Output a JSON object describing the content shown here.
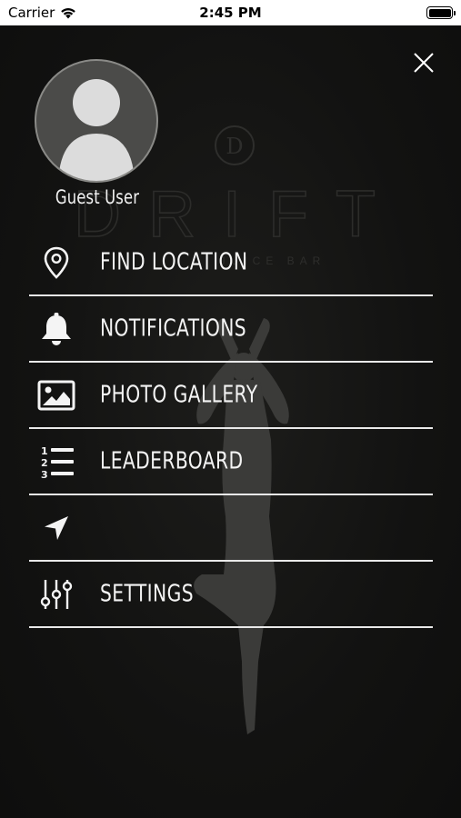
{
  "status_bar": {
    "carrier": "Carrier",
    "time": "2:45 PM"
  },
  "background": {
    "logo_text": "DRIFT",
    "logo_subtext": "JUICE BAR",
    "logo_letter": "D"
  },
  "user": {
    "name": "Guest User"
  },
  "menu": {
    "items": [
      {
        "label": "FIND LOCATION",
        "icon": "map-pin-icon"
      },
      {
        "label": "NOTIFICATIONS",
        "icon": "bell-icon"
      },
      {
        "label": "PHOTO GALLERY",
        "icon": "image-icon"
      },
      {
        "label": "LEADERBOARD",
        "icon": "numbered-list-icon"
      },
      {
        "label": "",
        "icon": "navigation-arrow-icon"
      },
      {
        "label": "SETTINGS",
        "icon": "sliders-icon"
      }
    ]
  },
  "colors": {
    "drawer_background": "#111110",
    "text": "#f4f4f4",
    "divider": "#e9e9e9",
    "avatar": "#4b4b49"
  }
}
